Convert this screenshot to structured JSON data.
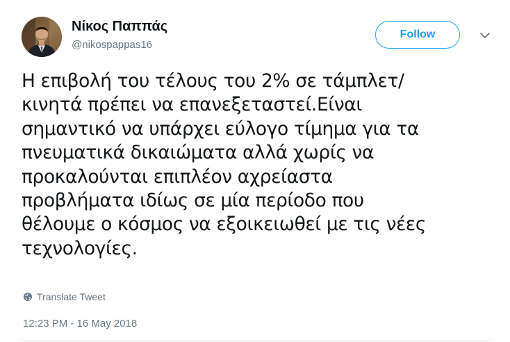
{
  "author": {
    "name": "Νίκος Παππάς",
    "handle": "@nikospappas16"
  },
  "follow_button": {
    "label": "Follow"
  },
  "tweet": {
    "lines": [
      "Η επιβολή του τέλους του 2% σε τάμπλετ/",
      "κινητά πρέπει να επανεξεταστεί.Είναι",
      "σημαντικό να υπάρχει εύλογο τίμημα για τα",
      "πνευματικά δικαιώματα αλλά χωρίς να",
      "προκαλούνται επιπλέον αχρείαστα",
      "προβλήματα ιδίως σε μία περίοδο που",
      "θέλουμε ο κόσμος να εξοικειωθεί με τις νέες",
      "τεχνολογίες."
    ]
  },
  "translate": {
    "label": "Translate Tweet",
    "icon": "globe-icon"
  },
  "timestamp": "12:23 PM - 16 May 2018",
  "colors": {
    "accent": "#1da1f2",
    "text": "#14171a",
    "muted": "#657786",
    "divider": "#e6ecf0"
  }
}
